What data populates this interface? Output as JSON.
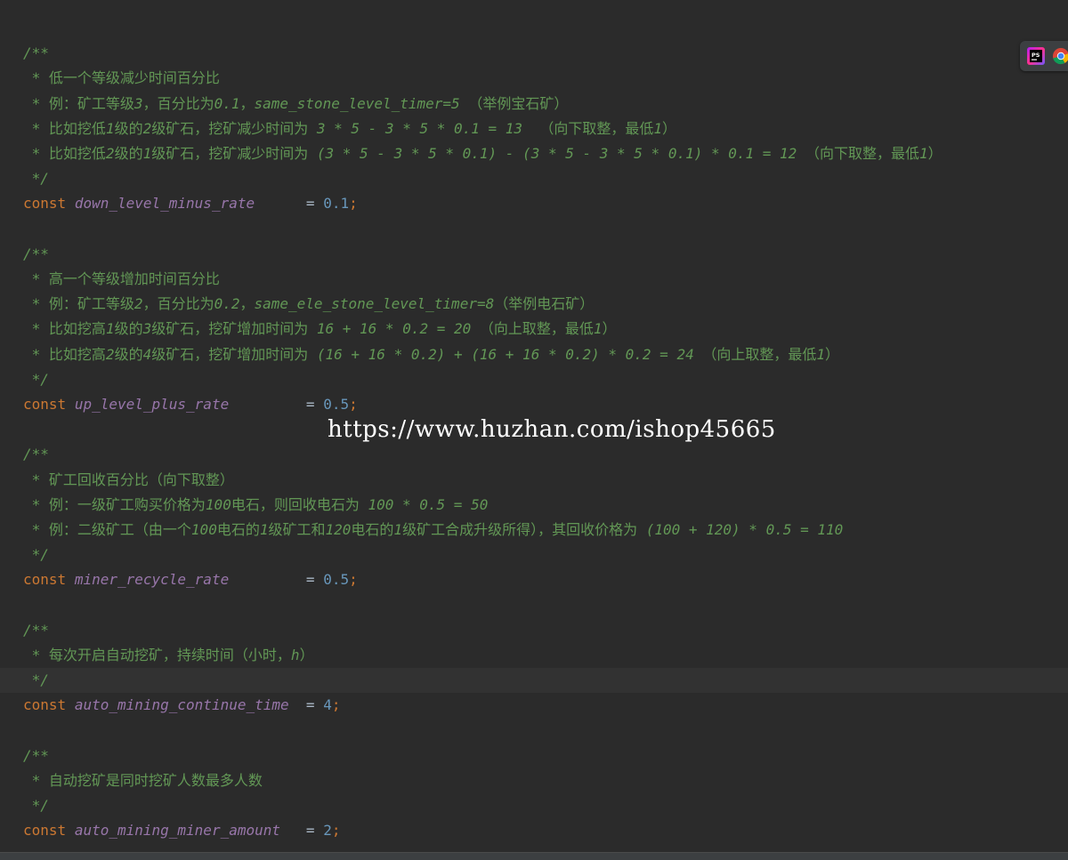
{
  "editor": {
    "lines": [
      {
        "kind": "blank"
      },
      {
        "kind": "comment",
        "text": "/**"
      },
      {
        "kind": "comment",
        "text": " * 低一个等级减少时间百分比"
      },
      {
        "kind": "comment",
        "text": " * 例：矿工等级3，百分比为0.1，same_stone_level_timer=5 （举例宝石矿）"
      },
      {
        "kind": "comment",
        "text": " * 比如挖低1级的2级矿石，挖矿减少时间为 3 * 5 - 3 * 5 * 0.1 = 13  （向下取整，最低1）"
      },
      {
        "kind": "comment",
        "text": " * 比如挖低2级的1级矿石，挖矿减少时间为 (3 * 5 - 3 * 5 * 0.1) - (3 * 5 - 3 * 5 * 0.1) * 0.1 = 12 （向下取整，最低1）"
      },
      {
        "kind": "comment",
        "text": " */"
      },
      {
        "kind": "code",
        "keyword": "const",
        "name": "down_level_minus_rate",
        "pad": "     ",
        "op": "=",
        "value": "0.1",
        "semi": ";"
      },
      {
        "kind": "blank"
      },
      {
        "kind": "comment",
        "text": "/**"
      },
      {
        "kind": "comment",
        "text": " * 高一个等级增加时间百分比"
      },
      {
        "kind": "comment",
        "text": " * 例：矿工等级2，百分比为0.2，same_ele_stone_level_timer=8（举例电石矿）"
      },
      {
        "kind": "comment",
        "text": " * 比如挖高1级的3级矿石，挖矿增加时间为 16 + 16 * 0.2 = 20 （向上取整，最低1）"
      },
      {
        "kind": "comment",
        "text": " * 比如挖高2级的4级矿石，挖矿增加时间为 (16 + 16 * 0.2) + (16 + 16 * 0.2) * 0.2 = 24 （向上取整，最低1）"
      },
      {
        "kind": "comment",
        "text": " */"
      },
      {
        "kind": "code",
        "keyword": "const",
        "name": "up_level_plus_rate",
        "pad": "        ",
        "op": "=",
        "value": "0.5",
        "semi": ";"
      },
      {
        "kind": "blank"
      },
      {
        "kind": "comment",
        "text": "/**"
      },
      {
        "kind": "comment",
        "text": " * 矿工回收百分比（向下取整）"
      },
      {
        "kind": "comment",
        "text": " * 例：一级矿工购买价格为100电石，则回收电石为 100 * 0.5 = 50"
      },
      {
        "kind": "comment",
        "text": " * 例：二级矿工（由一个100电石的1级矿工和120电石的1级矿工合成升级所得），其回收价格为 (100 + 120) * 0.5 = 110"
      },
      {
        "kind": "comment",
        "text": " */"
      },
      {
        "kind": "code",
        "keyword": "const",
        "name": "miner_recycle_rate",
        "pad": "        ",
        "op": "=",
        "value": "0.5",
        "semi": ";"
      },
      {
        "kind": "blank"
      },
      {
        "kind": "comment",
        "text": "/**"
      },
      {
        "kind": "comment",
        "text": " * 每次开启自动挖矿，持续时间（小时，h）"
      },
      {
        "kind": "comment",
        "text": " */",
        "highlight": true
      },
      {
        "kind": "code",
        "keyword": "const",
        "name": "auto_mining_continue_time",
        "pad": " ",
        "op": "=",
        "value": "4",
        "semi": ";"
      },
      {
        "kind": "blank"
      },
      {
        "kind": "comment",
        "text": "/**"
      },
      {
        "kind": "comment",
        "text": " * 自动挖矿是同时挖矿人数最多人数"
      },
      {
        "kind": "comment",
        "text": " */"
      },
      {
        "kind": "code",
        "keyword": "const",
        "name": "auto_mining_miner_amount",
        "pad": "  ",
        "op": "=",
        "value": "2",
        "semi": ";"
      }
    ]
  },
  "watermark": {
    "text": "https://www.huzhan.com/ishop45665"
  },
  "toolbar": {
    "icons": [
      {
        "name": "phpstorm-icon",
        "label": "PS"
      },
      {
        "name": "chrome-icon"
      }
    ]
  },
  "colors": {
    "background": "#2b2b2b",
    "comment": "#629755",
    "keyword": "#cc7832",
    "identifier": "#9876aa",
    "number": "#6897bb",
    "operator": "#a9b7c6"
  }
}
